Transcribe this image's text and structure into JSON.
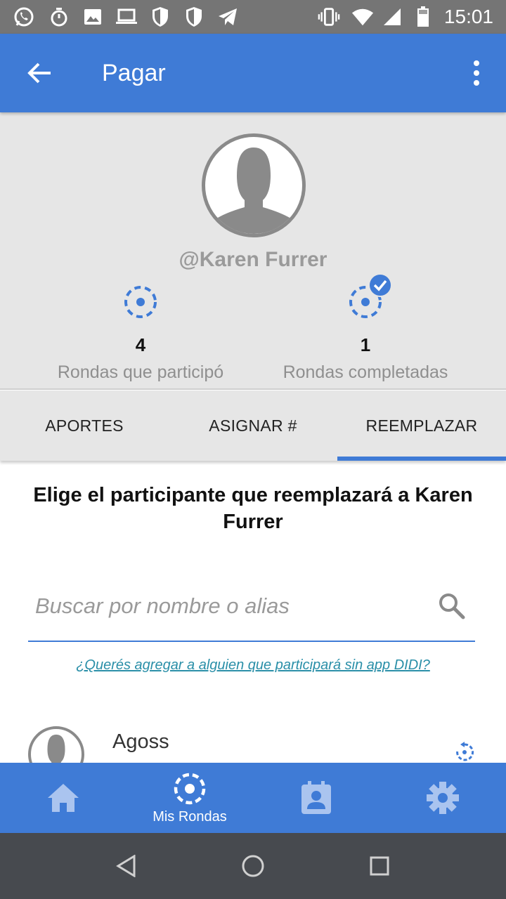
{
  "status_bar": {
    "time": "15:01",
    "icons": [
      "whatsapp-icon",
      "stopwatch-icon",
      "image-icon",
      "laptop-icon",
      "shield-icon",
      "shield-icon",
      "telegram-icon",
      "vibrate-icon",
      "wifi-icon",
      "signal-icon",
      "battery-icon"
    ]
  },
  "app_bar": {
    "title": "Pagar",
    "back_icon": "arrow-back-icon",
    "menu_icon": "more-vert-icon"
  },
  "profile": {
    "username": "@Karen Furrer",
    "stats": [
      {
        "value": "4",
        "label": "Rondas que participó",
        "icon": "rondas-dashed-circle-icon"
      },
      {
        "value": "1",
        "label": "Rondas completadas",
        "icon": "rondas-completed-icon"
      }
    ]
  },
  "tabs": [
    {
      "label": "APORTES",
      "active": false
    },
    {
      "label": "ASIGNAR #",
      "active": false
    },
    {
      "label": "REEMPLAZAR",
      "active": true
    }
  ],
  "content": {
    "heading": "Elige el participante que reemplazará a Karen Furrer",
    "search": {
      "placeholder": "Buscar por nombre o alias",
      "value": ""
    },
    "add_link": "¿Querés agregar a alguien que participará sin app DIDI?",
    "participants": [
      {
        "name": "Agoss"
      }
    ]
  },
  "bottom_nav": [
    {
      "icon": "home-icon",
      "label": ""
    },
    {
      "icon": "rondas-icon",
      "label": "Mis Rondas"
    },
    {
      "icon": "calendar-contact-icon",
      "label": ""
    },
    {
      "icon": "settings-icon",
      "label": ""
    }
  ],
  "colors": {
    "primary": "#3f7bd6",
    "status_bar": "#757575",
    "profile_bg": "#e6e6e6",
    "link": "#2a8fa8",
    "system_nav": "#474a4f"
  }
}
